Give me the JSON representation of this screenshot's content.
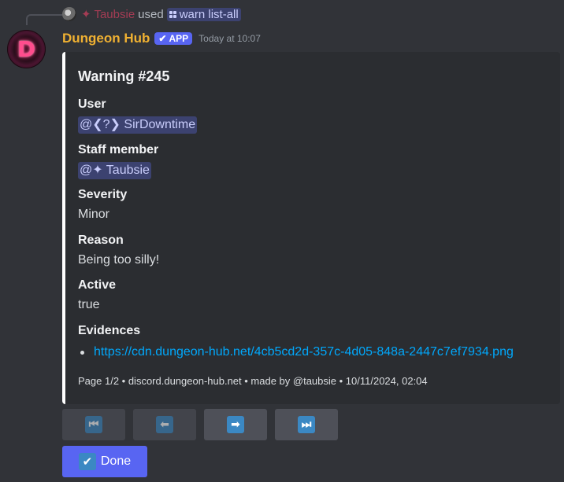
{
  "reply": {
    "user_display": "✦ Taubsie",
    "used_text": "used",
    "command": "warn list-all"
  },
  "bot": {
    "avatar_letter": "D",
    "name": "Dungeon Hub",
    "badge": "APP",
    "badge_check": "✔",
    "timestamp": "Today at 10:07"
  },
  "embed": {
    "title": "Warning #245",
    "fields": [
      {
        "name": "User",
        "value": "@❮?❯ SirDowntime"
      },
      {
        "name": "Staff member",
        "value": "@✦ Taubsie"
      },
      {
        "name": "Severity",
        "value": "Minor"
      },
      {
        "name": "Reason",
        "value": "Being too silly!"
      },
      {
        "name": "Active",
        "value": "true"
      },
      {
        "name": "Evidences",
        "value": "https://cdn.dungeon-hub.net/4cb5cd2d-357c-4d05-848a-2447c7ef7934.png"
      }
    ],
    "footer": "Page 1/2 • discord.dungeon-hub.net • made by @taubsie • 10/11/2024, 02:04",
    "accent_color": "#ffffff"
  },
  "buttons": {
    "first": {
      "icon": "⏮",
      "icon_name": "first-page-icon",
      "disabled": true
    },
    "prev": {
      "icon": "⬅",
      "icon_name": "previous-page-icon",
      "disabled": true
    },
    "next": {
      "icon": "➡",
      "icon_name": "next-page-icon",
      "disabled": false
    },
    "last": {
      "icon": "⏭",
      "icon_name": "last-page-icon",
      "disabled": false
    },
    "done": {
      "icon": "✔",
      "label": "Done"
    }
  },
  "colors": {
    "background": "#313338",
    "embed_bg": "#2b2d31",
    "bot_name": "#f0b132",
    "blurple": "#5865f2",
    "link": "#00a8fc",
    "mention_bg": "#3c4270"
  }
}
